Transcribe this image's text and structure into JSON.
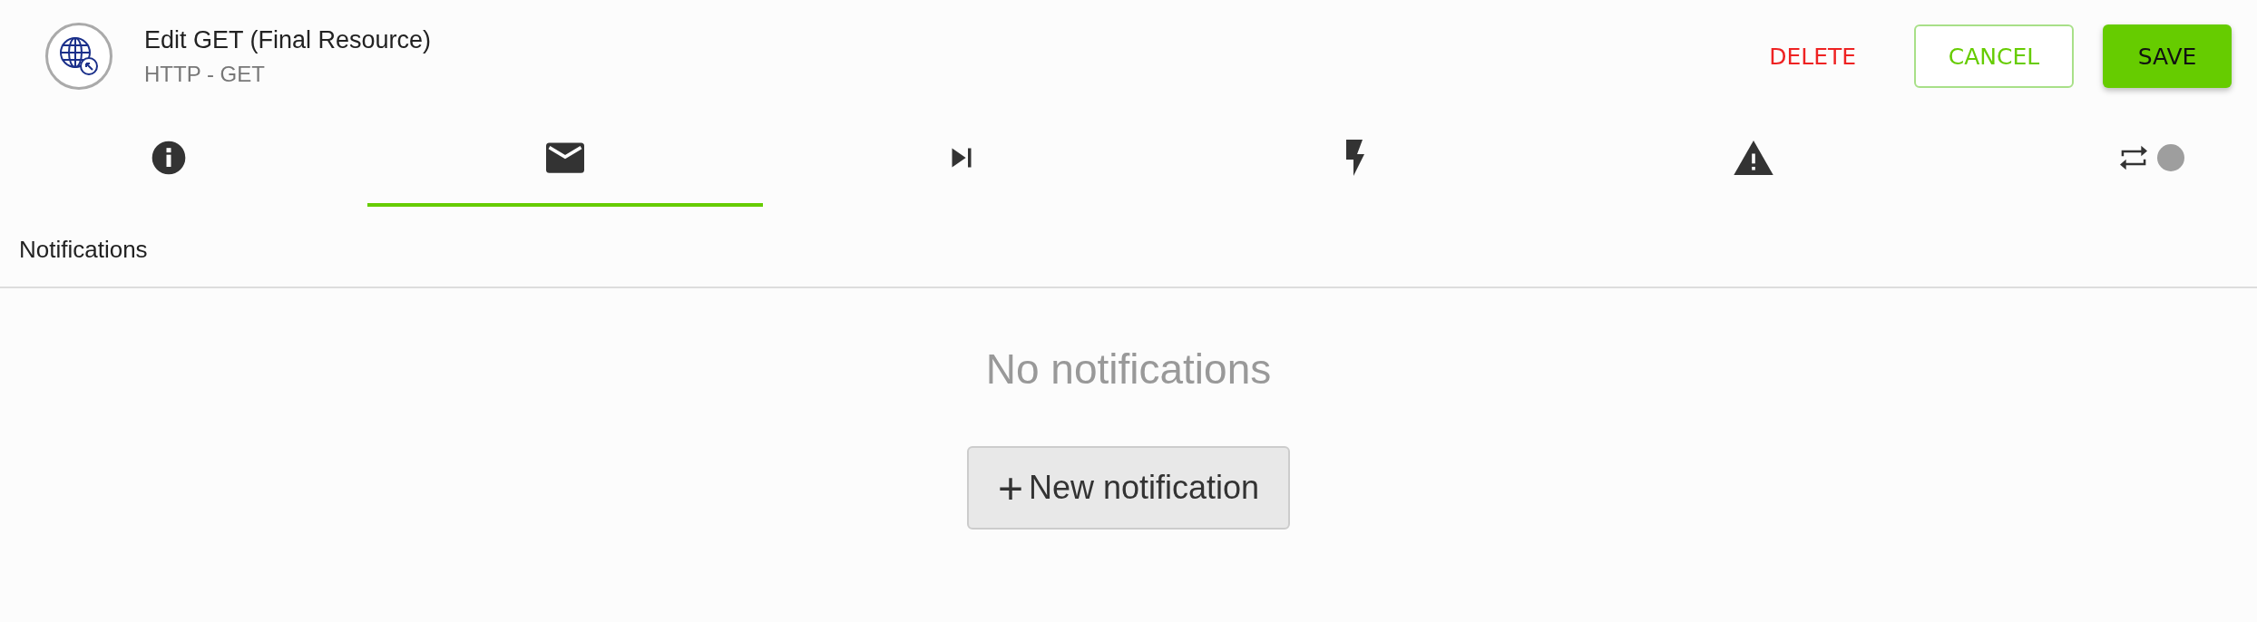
{
  "header": {
    "title": "Edit GET (Final Resource)",
    "subtitle": "HTTP - GET"
  },
  "actions": [
    {
      "kind": "danger",
      "label": "DELETE"
    },
    {
      "kind": "outline",
      "label": "CANCEL"
    },
    {
      "kind": "primary",
      "label": "SAVE"
    }
  ],
  "tabs": [
    {
      "kind": "info",
      "selected": false
    },
    {
      "kind": "mail",
      "selected": true
    },
    {
      "kind": "skip",
      "selected": false
    },
    {
      "kind": "bolt",
      "selected": false
    },
    {
      "kind": "warning",
      "selected": false
    },
    {
      "kind": "swap",
      "selected": false
    }
  ],
  "section": {
    "title": "Notifications",
    "empty_text": "No notifications",
    "add_button": {
      "icon": "+",
      "label": "New notification"
    }
  }
}
